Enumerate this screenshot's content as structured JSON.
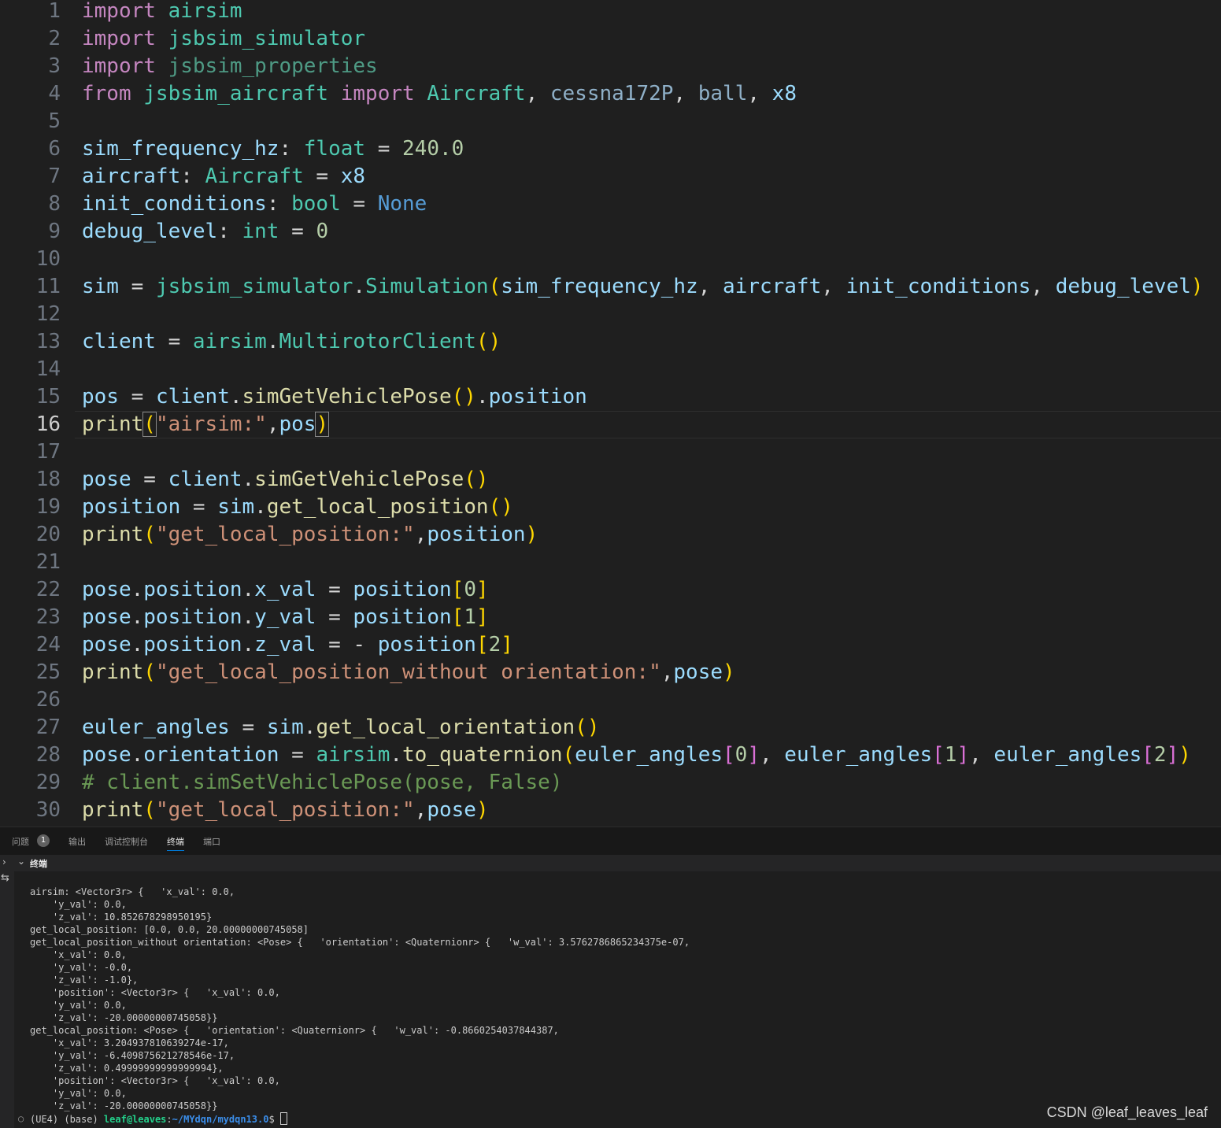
{
  "editor": {
    "current_line": "16",
    "line_numbers": [
      "1",
      "2",
      "3",
      "4",
      "5",
      "6",
      "7",
      "8",
      "9",
      "10",
      "11",
      "12",
      "13",
      "14",
      "15",
      "16",
      "17",
      "18",
      "19",
      "20",
      "21",
      "22",
      "23",
      "24",
      "25",
      "26",
      "27",
      "28",
      "29",
      "30"
    ],
    "tokens": {
      "l1": [
        "import",
        " ",
        "airsim"
      ],
      "l2": [
        "import",
        " ",
        "jsbsim_simulator"
      ],
      "l3": [
        "import",
        " ",
        "jsbsim_properties"
      ],
      "l4": [
        "from",
        " ",
        "jsbsim_aircraft",
        " ",
        "import",
        " ",
        "Aircraft",
        ", ",
        "cessna172P",
        ", ",
        "ball",
        ", ",
        "x8"
      ],
      "l6": [
        "sim_frequency_hz",
        ": ",
        "float",
        " = ",
        "240.0"
      ],
      "l7": [
        "aircraft",
        ": ",
        "Aircraft",
        " = ",
        "x8"
      ],
      "l8": [
        "init_conditions",
        ": ",
        "bool",
        " = ",
        "None"
      ],
      "l9": [
        "debug_level",
        ": ",
        "int",
        " = ",
        "0"
      ],
      "l11": [
        "sim",
        " = ",
        "jsbsim_simulator",
        ".",
        "Simulation",
        "(",
        "sim_frequency_hz",
        ", ",
        "aircraft",
        ", ",
        "init_conditions",
        ", ",
        "debug_level",
        ")"
      ],
      "l13": [
        "client",
        " = ",
        "airsim",
        ".",
        "MultirotorClient",
        "()"
      ],
      "l15": [
        "pos",
        " = ",
        "client",
        ".",
        "simGetVehiclePose",
        "()",
        ".",
        "position"
      ],
      "l16": [
        "print",
        "(",
        "\"airsim:\"",
        ",",
        "pos",
        ")"
      ],
      "l18": [
        "pose",
        " = ",
        "client",
        ".",
        "simGetVehiclePose",
        "()"
      ],
      "l19": [
        "position",
        " = ",
        "sim",
        ".",
        "get_local_position",
        "()"
      ],
      "l20": [
        "print",
        "(",
        "\"get_local_position:\"",
        ",",
        "position",
        ")"
      ],
      "l22": [
        "pose",
        ".",
        "position",
        ".",
        "x_val",
        " = ",
        "position",
        "[",
        "0",
        "]"
      ],
      "l23": [
        "pose",
        ".",
        "position",
        ".",
        "y_val",
        " = ",
        "position",
        "[",
        "1",
        "]"
      ],
      "l24": [
        "pose",
        ".",
        "position",
        ".",
        "z_val",
        " = - ",
        "position",
        "[",
        "2",
        "]"
      ],
      "l25": [
        "print",
        "(",
        "\"get_local_position_without orientation:\"",
        ",",
        "pose",
        ")"
      ],
      "l27": [
        "euler_angles",
        " = ",
        "sim",
        ".",
        "get_local_orientation",
        "()"
      ],
      "l28": [
        "pose",
        ".",
        "orientation",
        " = ",
        "airsim",
        ".",
        "to_quaternion",
        "(",
        "euler_angles",
        "[",
        "0",
        "]",
        ", ",
        "euler_angles",
        "[",
        "1",
        "]",
        ", ",
        "euler_angles",
        "[",
        "2",
        "]",
        ")"
      ],
      "l29": [
        "# client.simSetVehiclePose(pose, False)"
      ],
      "l30": [
        "print",
        "(",
        "\"get_local_position:\"",
        ",",
        "pose",
        ")"
      ]
    }
  },
  "panel": {
    "tabs": {
      "problems": "问题",
      "problems_badge": "1",
      "output": "输出",
      "debug_console": "调试控制台",
      "terminal": "终端",
      "ports": "端口"
    },
    "terminal_header": "终端",
    "terminal_lines": [
      "airsim: <Vector3r> {   'x_val': 0.0,",
      "    'y_val': 0.0,",
      "    'z_val': 10.852678298950195}",
      "get_local_position: [0.0, 0.0, 20.00000000745058]",
      "get_local_position_without orientation: <Pose> {   'orientation': <Quaternionr> {   'w_val': 3.5762786865234375e-07,",
      "    'x_val': 0.0,",
      "    'y_val': -0.0,",
      "    'z_val': -1.0},",
      "    'position': <Vector3r> {   'x_val': 0.0,",
      "    'y_val': 0.0,",
      "    'z_val': -20.00000000745058}}",
      "get_local_position: <Pose> {   'orientation': <Quaternionr> {   'w_val': -0.8660254037844387,",
      "    'x_val': 3.204937810639274e-17,",
      "    'y_val': -6.409875621278546e-17,",
      "    'z_val': 0.49999999999999994},",
      "    'position': <Vector3r> {   'x_val': 0.0,",
      "    'y_val': 0.0,",
      "    'z_val': -20.00000000745058}}"
    ],
    "prompt": {
      "env": "(UE4) (base) ",
      "user_host": "leaf@leaves",
      "sep": ":",
      "path": "~/MYdqn/mydqn13.0",
      "symbol": "$ "
    }
  },
  "watermark": "CSDN @leaf_leaves_leaf"
}
